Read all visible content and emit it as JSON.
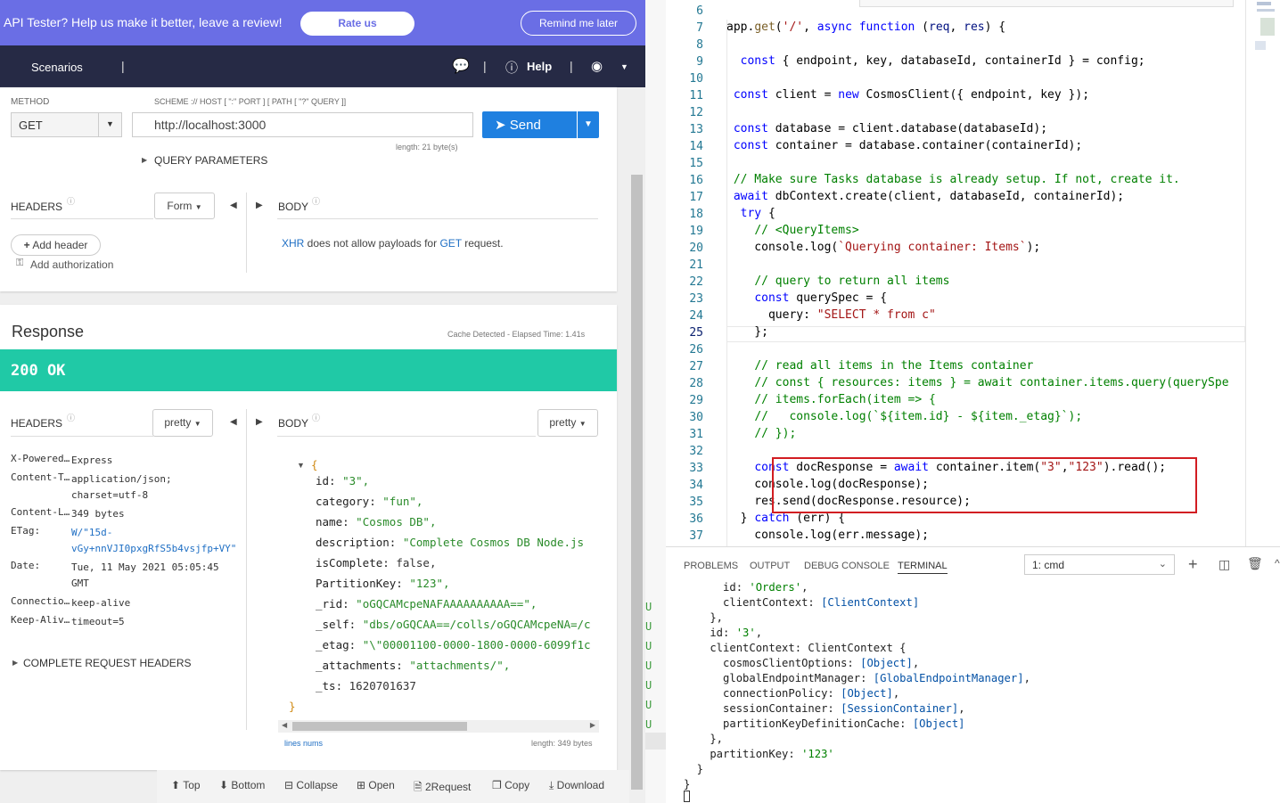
{
  "banner": {
    "message": "API Tester? Help us make it better, leave a review!",
    "rate": "Rate us",
    "remind": "Remind me later"
  },
  "nav": {
    "scenarios": "Scenarios",
    "help": "Help",
    "sep": "|"
  },
  "request": {
    "method_label": "METHOD",
    "scheme_label": "SCHEME :// HOST [ \":\" PORT ] [ PATH [ \"?\" QUERY ]]",
    "method": "GET",
    "url": "http://localhost:3000",
    "send": "Send",
    "length": "length: 21 byte(s)",
    "query_params": "QUERY PARAMETERS",
    "headers": "HEADERS",
    "form": "Form",
    "body": "BODY",
    "add_header": "Add header",
    "add_auth": "Add authorization",
    "xhr": "XHR",
    "xhr_text": " does not allow payloads for ",
    "get": "GET",
    "request_word": " request."
  },
  "response": {
    "title": "Response",
    "cache": "Cache Detected - Elapsed Time: 1.41s",
    "status": "200 OK",
    "headers": "HEADERS",
    "body": "BODY",
    "pretty": "pretty",
    "complete_headers": "COMPLETE REQUEST HEADERS",
    "lines_nums": "lines nums",
    "length": "length: 349 bytes",
    "header_rows": [
      {
        "k": "X-Powered…",
        "v": "Express"
      },
      {
        "k": "Content-T…",
        "v": "application/json; charset=utf-8"
      },
      {
        "k": "Content-L…",
        "v": "349 bytes"
      },
      {
        "k": "ETag:",
        "v": "W/\"15d-vGy+nnVJI0pxgRfS5b4vsjfp+VY\""
      },
      {
        "k": "Date:",
        "v": "Tue, 11 May 2021 05:05:45 GMT"
      },
      {
        "k": "Connectio…",
        "v": "keep-alive"
      },
      {
        "k": "Keep-Aliv…",
        "v": "timeout=5"
      }
    ],
    "json_lines": [
      {
        "k": "id:",
        "v": "\"3\","
      },
      {
        "k": "category:",
        "v": "\"fun\","
      },
      {
        "k": "name:",
        "v": "\"Cosmos DB\","
      },
      {
        "k": "description:",
        "v": "\"Complete Cosmos DB Node.js"
      },
      {
        "k": "isComplete:",
        "v": "false,"
      },
      {
        "k": "PartitionKey:",
        "v": "\"123\","
      },
      {
        "k": "_rid:",
        "v": "\"oGQCAMcpeNAFAAAAAAAAAA==\","
      },
      {
        "k": "_self:",
        "v": "\"dbs/oGQCAA==/colls/oGQCAMcpeNA=/c"
      },
      {
        "k": "_etag:",
        "v": "\"\\\"00001100-0000-1800-0000-6099f1c"
      },
      {
        "k": "_attachments:",
        "v": "\"attachments/\","
      },
      {
        "k": "_ts:",
        "v": "1620701637"
      }
    ],
    "open_brace": "{",
    "close_brace": "}"
  },
  "toolbar": {
    "top": "Top",
    "bottom": "Bottom",
    "collapse": "Collapse",
    "open": "Open",
    "to_request": "2Request",
    "copy": "Copy",
    "download": "Download"
  },
  "editor": {
    "lines": [
      {
        "n": "6",
        "html": ""
      },
      {
        "n": "7",
        "html": "app.<span class='fn'>get</span>(<span class='st'>'/'</span>, <span class='kw'>async</span> <span class='kw'>function</span> (<span class='pr'>req</span>, <span class='pr'>res</span>) {"
      },
      {
        "n": "8",
        "html": ""
      },
      {
        "n": "9",
        "html": "  <span class='kw'>const</span> { endpoint, key, databaseId, containerId } = config;"
      },
      {
        "n": "10",
        "html": ""
      },
      {
        "n": "11",
        "html": " <span class='kw'>const</span> client = <span class='kw'>new</span> CosmosClient({ endpoint, key });"
      },
      {
        "n": "12",
        "html": ""
      },
      {
        "n": "13",
        "html": " <span class='kw'>const</span> database = client.database(databaseId);"
      },
      {
        "n": "14",
        "html": " <span class='kw'>const</span> container = database.container(containerId);"
      },
      {
        "n": "15",
        "html": ""
      },
      {
        "n": "16",
        "html": " <span class='cm'>// Make sure Tasks database is already setup. If not, create it.</span>"
      },
      {
        "n": "17",
        "html": " <span class='kw'>await</span> dbContext.create(client, databaseId, containerId);"
      },
      {
        "n": "18",
        "html": "  <span class='kw'>try</span> {"
      },
      {
        "n": "19",
        "html": "    <span class='cm'>// &lt;QueryItems&gt;</span>"
      },
      {
        "n": "20",
        "html": "    console.log(<span class='st'>`Querying container: Items`</span>);"
      },
      {
        "n": "21",
        "html": ""
      },
      {
        "n": "22",
        "html": "    <span class='cm'>// query to return all items</span>"
      },
      {
        "n": "23",
        "html": "    <span class='kw'>const</span> querySpec = {"
      },
      {
        "n": "24",
        "html": "      query: <span class='st'>\"SELECT * from c\"</span>"
      },
      {
        "n": "25",
        "html": "    };"
      },
      {
        "n": "26",
        "html": ""
      },
      {
        "n": "27",
        "html": "    <span class='cm'>// read all items in the Items container</span>"
      },
      {
        "n": "28",
        "html": "    <span class='cm'>// const { resources: items } = await container.items.query(querySpe</span>"
      },
      {
        "n": "29",
        "html": "    <span class='cm'>// items.forEach(item =&gt; {</span>"
      },
      {
        "n": "30",
        "html": "    <span class='cm'>//   console.log(`${item.id} - ${item._etag}`);</span>"
      },
      {
        "n": "31",
        "html": "    <span class='cm'>// });</span>"
      },
      {
        "n": "32",
        "html": ""
      },
      {
        "n": "33",
        "html": "    <span class='kw'>const</span> docResponse = <span class='kw'>await</span> container.item(<span class='st'>\"3\"</span>,<span class='st'>\"123\"</span>).read();"
      },
      {
        "n": "34",
        "html": "    console.log(docResponse);"
      },
      {
        "n": "35",
        "html": "    res.send(docResponse.resource);"
      },
      {
        "n": "36",
        "html": "  } <span class='kw'>catch</span> (err) {"
      },
      {
        "n": "37",
        "html": "    console.log(err.message);"
      }
    ]
  },
  "terminal": {
    "tabs": [
      "PROBLEMS",
      "OUTPUT",
      "DEBUG CONSOLE",
      "TERMINAL"
    ],
    "selected": "1: cmd",
    "lines": [
      {
        "i": "      ",
        "html": "id: <span class='gr'>'Orders'</span>,"
      },
      {
        "i": "      ",
        "html": "clientContext: <span class='cy'>[ClientContext]</span>"
      },
      {
        "i": "    ",
        "html": "},"
      },
      {
        "i": "    ",
        "html": "id: <span class='gr'>'3'</span>,"
      },
      {
        "i": "    ",
        "html": "clientContext: ClientContext {"
      },
      {
        "i": "      ",
        "html": "cosmosClientOptions: <span class='cy'>[Object]</span>,"
      },
      {
        "i": "      ",
        "html": "globalEndpointManager: <span class='cy'>[GlobalEndpointManager]</span>,"
      },
      {
        "i": "      ",
        "html": "connectionPolicy: <span class='cy'>[Object]</span>,"
      },
      {
        "i": "      ",
        "html": "sessionContainer: <span class='cy'>[SessionContainer]</span>,"
      },
      {
        "i": "      ",
        "html": "partitionKeyDefinitionCache: <span class='cy'>[Object]</span>"
      },
      {
        "i": "    ",
        "html": "},"
      },
      {
        "i": "    ",
        "html": "partitionKey: <span class='gr'>'123'</span>"
      },
      {
        "i": "  ",
        "html": "}"
      },
      {
        "i": "",
        "html": "}"
      }
    ]
  }
}
